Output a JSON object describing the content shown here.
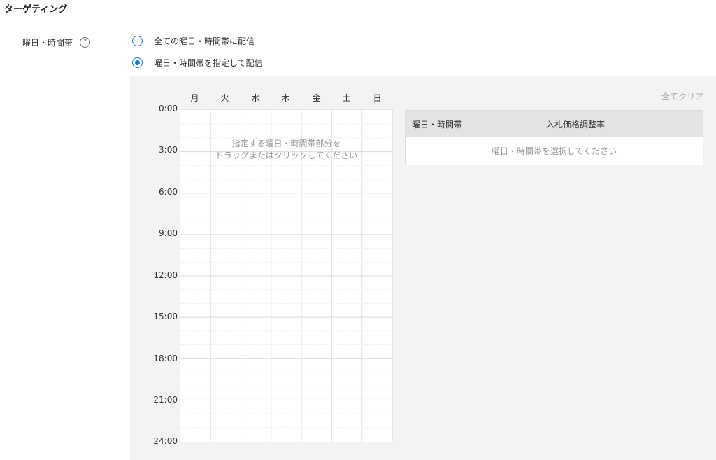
{
  "section": {
    "title": "ターゲティング"
  },
  "field": {
    "label": "曜日・時間帯",
    "help_glyph": "?"
  },
  "options": [
    {
      "label": "全ての曜日・時間帯に配信",
      "checked": false
    },
    {
      "label": "曜日・時間帯を指定して配信",
      "checked": true
    }
  ],
  "schedule": {
    "days": [
      "月",
      "火",
      "水",
      "木",
      "金",
      "土",
      "日"
    ],
    "times": [
      "0:00",
      "3:00",
      "6:00",
      "9:00",
      "12:00",
      "15:00",
      "18:00",
      "21:00",
      "24:00"
    ],
    "hint_line1": "指定する曜日・時間帯部分を",
    "hint_line2": "ドラッグまたはクリックしてください",
    "clear_label": "全てクリア"
  },
  "table": {
    "col1": "曜日・時間帯",
    "col2": "入札価格調整率",
    "empty": "曜日・時間帯を選択してください"
  },
  "colors": {
    "accent": "#1e6fd9",
    "panel_bg": "#f3f3f3"
  }
}
